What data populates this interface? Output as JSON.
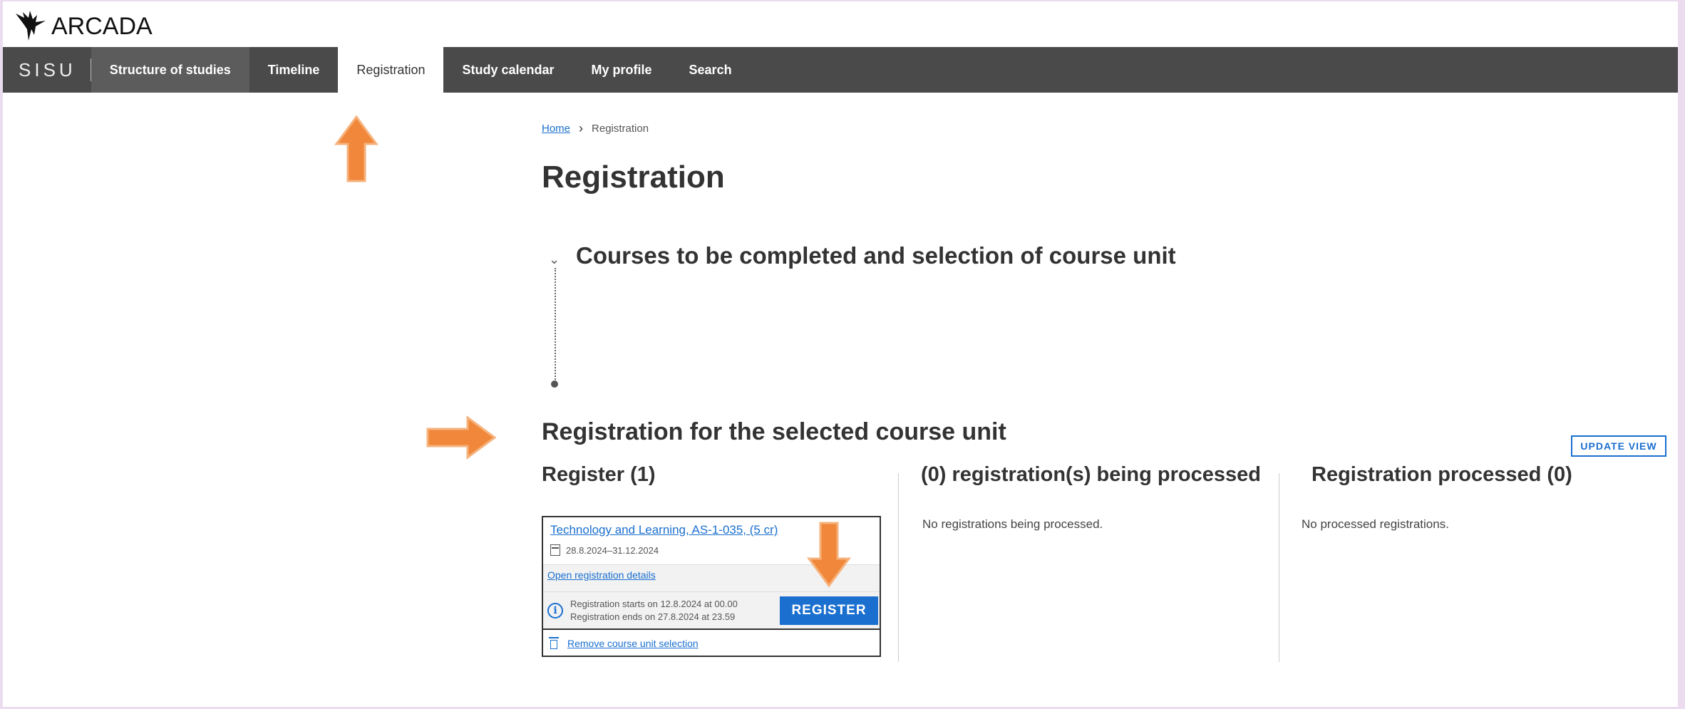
{
  "brand": {
    "logo_text": "ARCADA",
    "app_name": "SISU"
  },
  "nav": {
    "items": [
      {
        "label": "Structure of studies"
      },
      {
        "label": "Timeline"
      },
      {
        "label": "Registration"
      },
      {
        "label": "Study calendar"
      },
      {
        "label": "My profile"
      },
      {
        "label": "Search"
      }
    ],
    "active": "Registration"
  },
  "breadcrumb": {
    "home": "Home",
    "current": "Registration"
  },
  "page": {
    "title": "Registration"
  },
  "courses_section": {
    "title": "Courses to be completed and selection of course unit"
  },
  "registration_section": {
    "title": "Registration for the selected course unit",
    "update_button": "UPDATE VIEW",
    "register_column": {
      "title": "Register (1)",
      "card": {
        "course_link": "Technology and Learning, AS-1-035, (5 cr)",
        "dates": "28.8.2024–31.12.2024",
        "details_link": "Open registration details",
        "reg_starts": "Registration starts on 12.8.2024 at 00.00",
        "reg_ends": "Registration ends on 27.8.2024 at 23.59",
        "register_button": "REGISTER",
        "remove_link": "Remove course unit selection"
      }
    },
    "processing_column": {
      "title": "(0) registration(s) being processed",
      "empty": "No registrations being processed."
    },
    "processed_column": {
      "title": "Registration processed (0)",
      "empty": "No processed registrations."
    }
  },
  "colors": {
    "accent": "#1a6fcf",
    "navbar": "#4a4a4a",
    "annotation_arrow": "#f0873a"
  },
  "icons": [
    "arcada-bird-logo",
    "chevron-right-icon",
    "chevron-down-icon",
    "calendar-icon",
    "info-icon",
    "trash-icon",
    "annotation-arrow"
  ]
}
